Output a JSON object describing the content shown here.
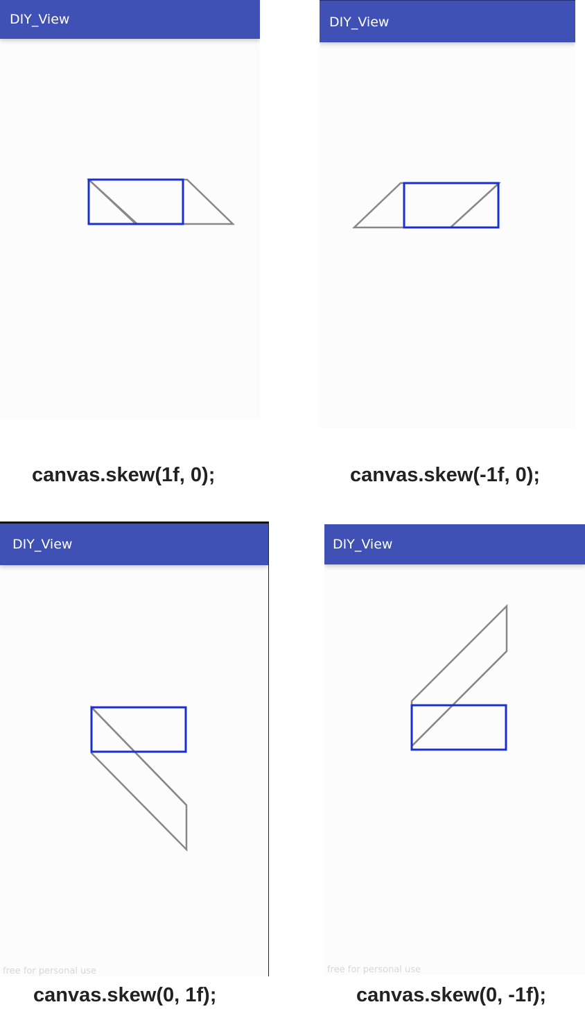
{
  "panels": [
    {
      "app_title": "DIY_View",
      "caption": "canvas.skew(1f, 0);",
      "watermark": ""
    },
    {
      "app_title": "DIY_View",
      "caption": "canvas.skew(-1f, 0);",
      "watermark": ""
    },
    {
      "app_title": "DIY_View",
      "caption": "canvas.skew(0, 1f);",
      "watermark": "free for personal use"
    },
    {
      "app_title": "DIY_View",
      "caption": "canvas.skew(0, -1f);",
      "watermark": "free for personal use"
    }
  ],
  "colors": {
    "app_bar": "#3f51b5",
    "reference_rect": "#1a2fd0",
    "skewed_shape": "#888888"
  }
}
